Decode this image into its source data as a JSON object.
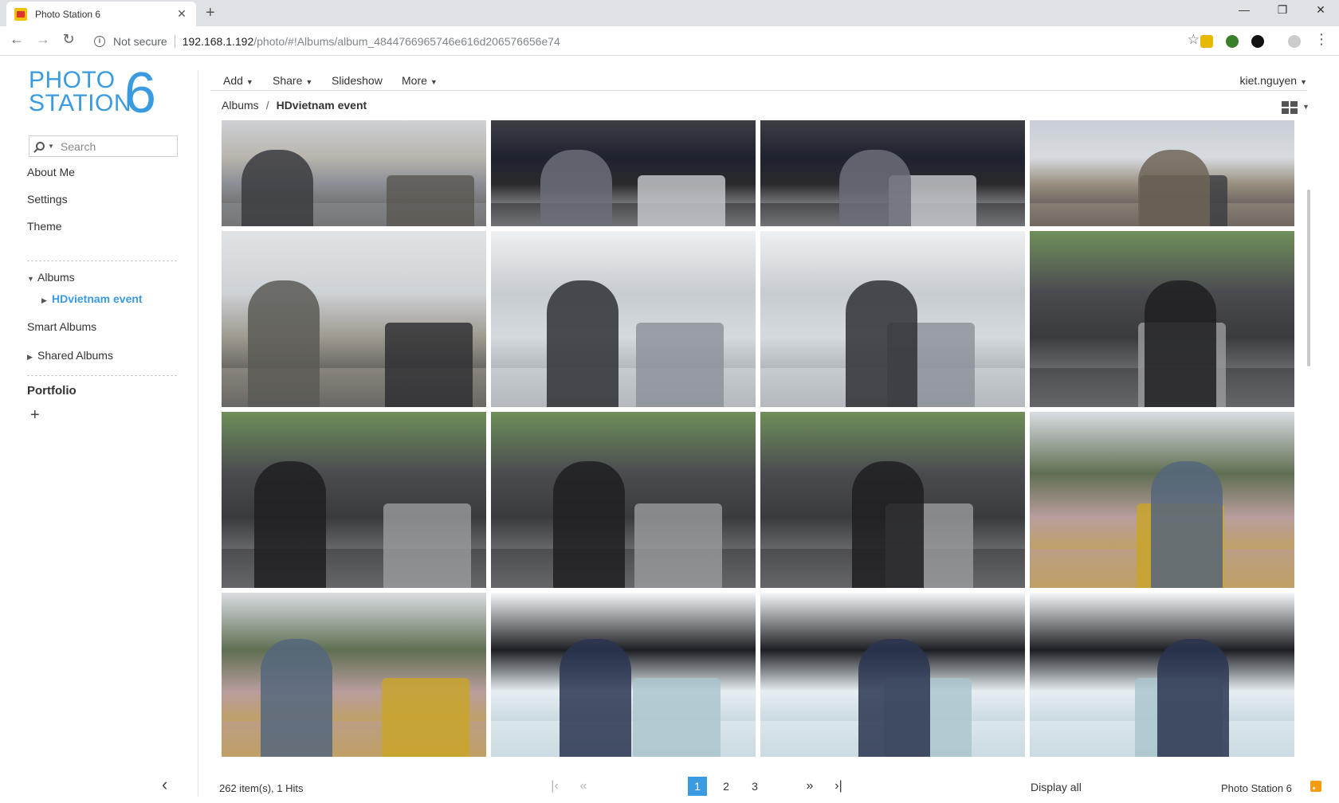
{
  "browser": {
    "tab_title": "Photo Station 6",
    "tab_close": "✕",
    "new_tab": "+",
    "minimize": "—",
    "restore": "❐",
    "close": "✕",
    "not_secure": "Not secure",
    "url_host": "192.168.1.192",
    "url_path": "/photo/#!Albums/album_4844766965746e616d206576656e74",
    "back": "←",
    "forward": "→",
    "reload": "↻",
    "star": "☆",
    "menu": "⋮"
  },
  "sidebar": {
    "logo_line1": "PHOTO",
    "logo_line2": "STATION",
    "logo_num": "6",
    "search_placeholder": "Search",
    "links": {
      "about": "About Me",
      "settings": "Settings",
      "theme": "Theme",
      "albums": "Albums",
      "current_album": "HDvietnam event",
      "smart_albums": "Smart Albums",
      "shared_albums": "Shared Albums",
      "portfolio": "Portfolio"
    },
    "add": "+",
    "collapse": "‹"
  },
  "menubar": {
    "add": "Add",
    "share": "Share",
    "slideshow": "Slideshow",
    "more": "More",
    "user": "kiet.nguyen"
  },
  "breadcrumb": {
    "root": "Albums",
    "separator": "/",
    "current": "HDvietnam event"
  },
  "photos": [
    {
      "scene": "crowd-exhibition"
    },
    {
      "scene": "headphone-booth"
    },
    {
      "scene": "headphone-booth"
    },
    {
      "scene": "man-with-phone"
    },
    {
      "scene": "men-looking-at-phone"
    },
    {
      "scene": "vendor-table-outdoor"
    },
    {
      "scene": "vendor-table-outdoor"
    },
    {
      "scene": "headphones-display"
    },
    {
      "scene": "headphones-display"
    },
    {
      "scene": "headphones-display"
    },
    {
      "scene": "headphones-display"
    },
    {
      "scene": "vifa-speakers"
    },
    {
      "scene": "vifa-speakers"
    },
    {
      "scene": "speaker-with-microphone"
    },
    {
      "scene": "speaker-with-microphone"
    },
    {
      "scene": "speaker-with-microphone"
    }
  ],
  "footer": {
    "count": "262 item(s), 1 Hits",
    "pages": [
      "1",
      "2",
      "3"
    ],
    "current_page": "1",
    "first": "|‹",
    "prev": "«",
    "next": "»",
    "last": "›|",
    "display_all": "Display all",
    "brand": "Photo Station 6"
  },
  "colors": {
    "accent": "#3a9be0",
    "rss": "#f39c12"
  }
}
